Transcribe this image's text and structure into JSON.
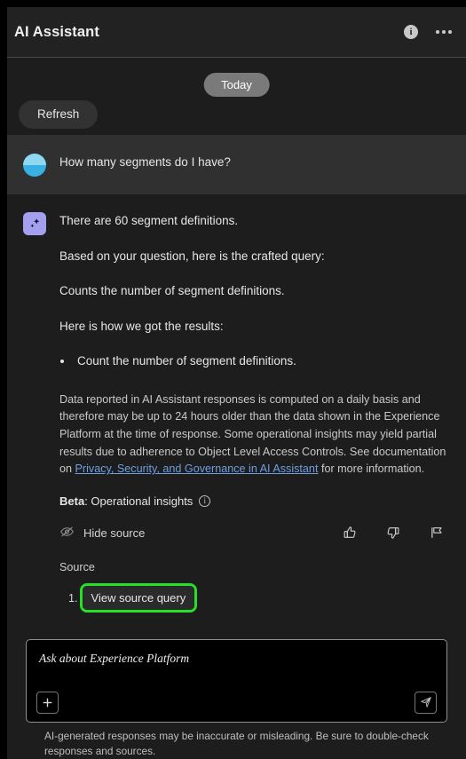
{
  "header": {
    "title": "AI Assistant",
    "info_icon": "info-circle-filled-icon",
    "info_glyph": "i",
    "more_icon": "more-options-icon"
  },
  "topbar": {
    "day_divider": "Today",
    "refresh_label": "Refresh"
  },
  "conversation": {
    "user_message": {
      "avatar": "user-avatar-pie-icon",
      "text": "How many segments do I have?"
    },
    "ai_message": {
      "avatar": "ai-sparkle-avatar-icon",
      "lines": [
        "There are 60 segment definitions.",
        "Based on your question, here is the crafted query:",
        "Counts the number of segment definitions.",
        "Here is how we got the results:"
      ],
      "bullets": [
        "Count the number of segment definitions."
      ],
      "disclaimer": {
        "part1": "Data reported in AI Assistant responses is computed on a daily basis and therefore may be up to 24 hours older than the data shown in the Experience Platform at the time of response. Some operational insights may yield partial results due to adherence to Object Level Access Controls. See documentation on ",
        "link": "Privacy, Security, and Governance in AI Assistant",
        "part2": " for more information."
      },
      "beta": {
        "label": "Beta",
        "text": ": Operational insights",
        "info_glyph": "i",
        "info_icon": "info-circle-outline-icon"
      },
      "actions": {
        "hide_source_label": "Hide source",
        "hide_source_icon": "eye-slash-icon",
        "thumbs_up_icon": "thumbs-up-icon",
        "thumbs_down_icon": "thumbs-down-icon",
        "flag_icon": "flag-icon"
      },
      "source": {
        "label": "Source",
        "item_number": "1.",
        "view_query_label": "View source query",
        "highlight_color": "#28e028"
      }
    }
  },
  "composer": {
    "placeholder": "Ask about Experience Platform",
    "value": "",
    "add_icon": "plus-icon",
    "send_icon": "send-paper-plane-icon"
  },
  "footnote": "AI-generated responses may be inaccurate or misleading. Be sure to double-check responses and sources.",
  "colors": {
    "window_bg": "#1d1d1d",
    "header_bg": "#222222",
    "user_msg_bg": "#303030",
    "accent_purple": "#a3a0ef",
    "accent_blue": "#38b0e3",
    "link_blue": "#6f9fe0",
    "highlight_green": "#28e028"
  }
}
